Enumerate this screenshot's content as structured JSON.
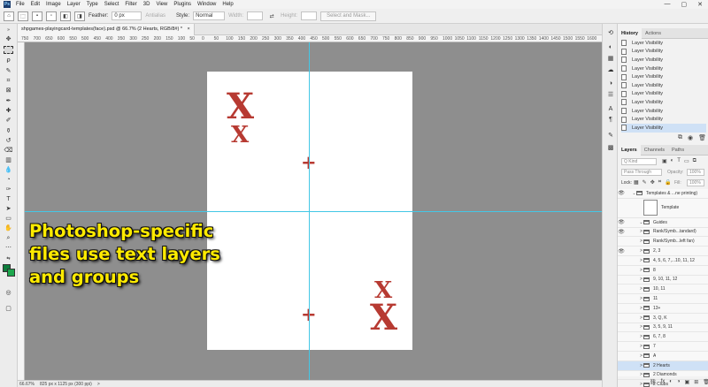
{
  "menubar": {
    "logo": "Ps",
    "items": [
      "File",
      "Edit",
      "Image",
      "Layer",
      "Type",
      "Select",
      "Filter",
      "3D",
      "View",
      "Plugins",
      "Window",
      "Help"
    ],
    "window_controls": [
      "—",
      "▢",
      "✕"
    ]
  },
  "options": {
    "feather_label": "Feather:",
    "feather_value": "0 px",
    "antialias_label": "Antialias",
    "style_label": "Style:",
    "style_value": "Normal",
    "width_label": "Width:",
    "height_label": "Height:",
    "select_mask_label": "Select and Mask..."
  },
  "document": {
    "tab_title": "shpgames-playingcard-templates(face).psd @ 66.7% (2 Hearts, RGB/8#) *",
    "tab_close": "×"
  },
  "ruler": {
    "top_ticks": [
      "750",
      "700",
      "650",
      "600",
      "550",
      "500",
      "450",
      "400",
      "350",
      "300",
      "250",
      "200",
      "150",
      "100",
      "50",
      "0",
      "50",
      "100",
      "150",
      "200",
      "250",
      "300",
      "350",
      "400",
      "450",
      "500",
      "550",
      "600",
      "650",
      "700",
      "750",
      "800",
      "850",
      "900",
      "950",
      "1000",
      "1050",
      "1100",
      "1150",
      "1200",
      "1250",
      "1300",
      "1350",
      "1400",
      "1450",
      "1500",
      "1550",
      "1600"
    ]
  },
  "card": {
    "rank_glyph": "X",
    "pip_glyph": "+"
  },
  "caption": {
    "line1": "Photoshop-specific",
    "line2": "files use text layers",
    "line3": "and groups"
  },
  "status": {
    "zoom": "66.67%",
    "size": "825 px x 1125 px (300 ppi)",
    "arrow": ">"
  },
  "history": {
    "tab_history": "History",
    "tab_actions": "Actions",
    "items": [
      "Layer Visibility",
      "Layer Visibility",
      "Layer Visibility",
      "Layer Visibility",
      "Layer Visibility",
      "Layer Visibility",
      "Layer Visibility",
      "Layer Visibility",
      "Layer Visibility",
      "Layer Visibility",
      "Layer Visibility"
    ],
    "footer_icons": [
      "⧉",
      "◉",
      "🗑"
    ]
  },
  "layers": {
    "tab_layers": "Layers",
    "tab_channels": "Channels",
    "tab_paths": "Paths",
    "kind_label": "Q Kind",
    "blend_mode": "Pass Through",
    "opacity_label": "Opacity:",
    "opacity_value": "100%",
    "lock_label": "Lock:",
    "fill_label": "Fill:",
    "fill_value": "100%",
    "rows": [
      {
        "name": "Templates & ...ne printing)",
        "eye": "👁",
        "chev": "⌄",
        "type": "folder"
      },
      {
        "name": "Template",
        "eye": "",
        "chev": "",
        "type": "thumb"
      },
      {
        "name": "Guides",
        "eye": "👁",
        "chev": "⌄",
        "type": "folder"
      },
      {
        "name": "Rank/Symb...tandard)",
        "eye": "👁",
        "chev": ">",
        "type": "folder"
      },
      {
        "name": "Rank/Symb...left fan)",
        "eye": "",
        "chev": ">",
        "type": "folder"
      },
      {
        "name": "2, 3",
        "eye": "👁",
        "chev": ">",
        "type": "folder"
      },
      {
        "name": "4, 5, 6, 7,...10, 11, 12",
        "eye": "",
        "chev": ">",
        "type": "folder"
      },
      {
        "name": "8",
        "eye": "",
        "chev": ">",
        "type": "folder"
      },
      {
        "name": "9, 10, 11, 12",
        "eye": "",
        "chev": ">",
        "type": "folder"
      },
      {
        "name": "10, 11",
        "eye": "",
        "chev": ">",
        "type": "folder"
      },
      {
        "name": "11",
        "eye": "",
        "chev": ">",
        "type": "folder"
      },
      {
        "name": "13+",
        "eye": "",
        "chev": ">",
        "type": "folder"
      },
      {
        "name": "3, Q, K",
        "eye": "",
        "chev": ">",
        "type": "folder"
      },
      {
        "name": "3, 5, 9, 11",
        "eye": "",
        "chev": ">",
        "type": "folder"
      },
      {
        "name": "6, 7, 8",
        "eye": "",
        "chev": ">",
        "type": "folder"
      },
      {
        "name": "7",
        "eye": "",
        "chev": ">",
        "type": "folder"
      },
      {
        "name": "A",
        "eye": "",
        "chev": ">",
        "type": "folder"
      },
      {
        "name": "2 Hearts",
        "eye": "",
        "chev": ">",
        "type": "folder",
        "selected": true
      },
      {
        "name": "2 Diamonds",
        "eye": "",
        "chev": ">",
        "type": "folder"
      },
      {
        "name": "2 Clubs",
        "eye": "",
        "chev": ">",
        "type": "folder"
      }
    ],
    "footer_icons": [
      "⛓",
      "fx",
      "◐",
      "◑",
      "▣",
      "⊞",
      "🗑"
    ]
  },
  "colors": {
    "accent_guide": "#43c7e6",
    "card_red": "#b73a32",
    "caption_yellow": "#ffeb00",
    "selection": "#cfe1f6"
  }
}
